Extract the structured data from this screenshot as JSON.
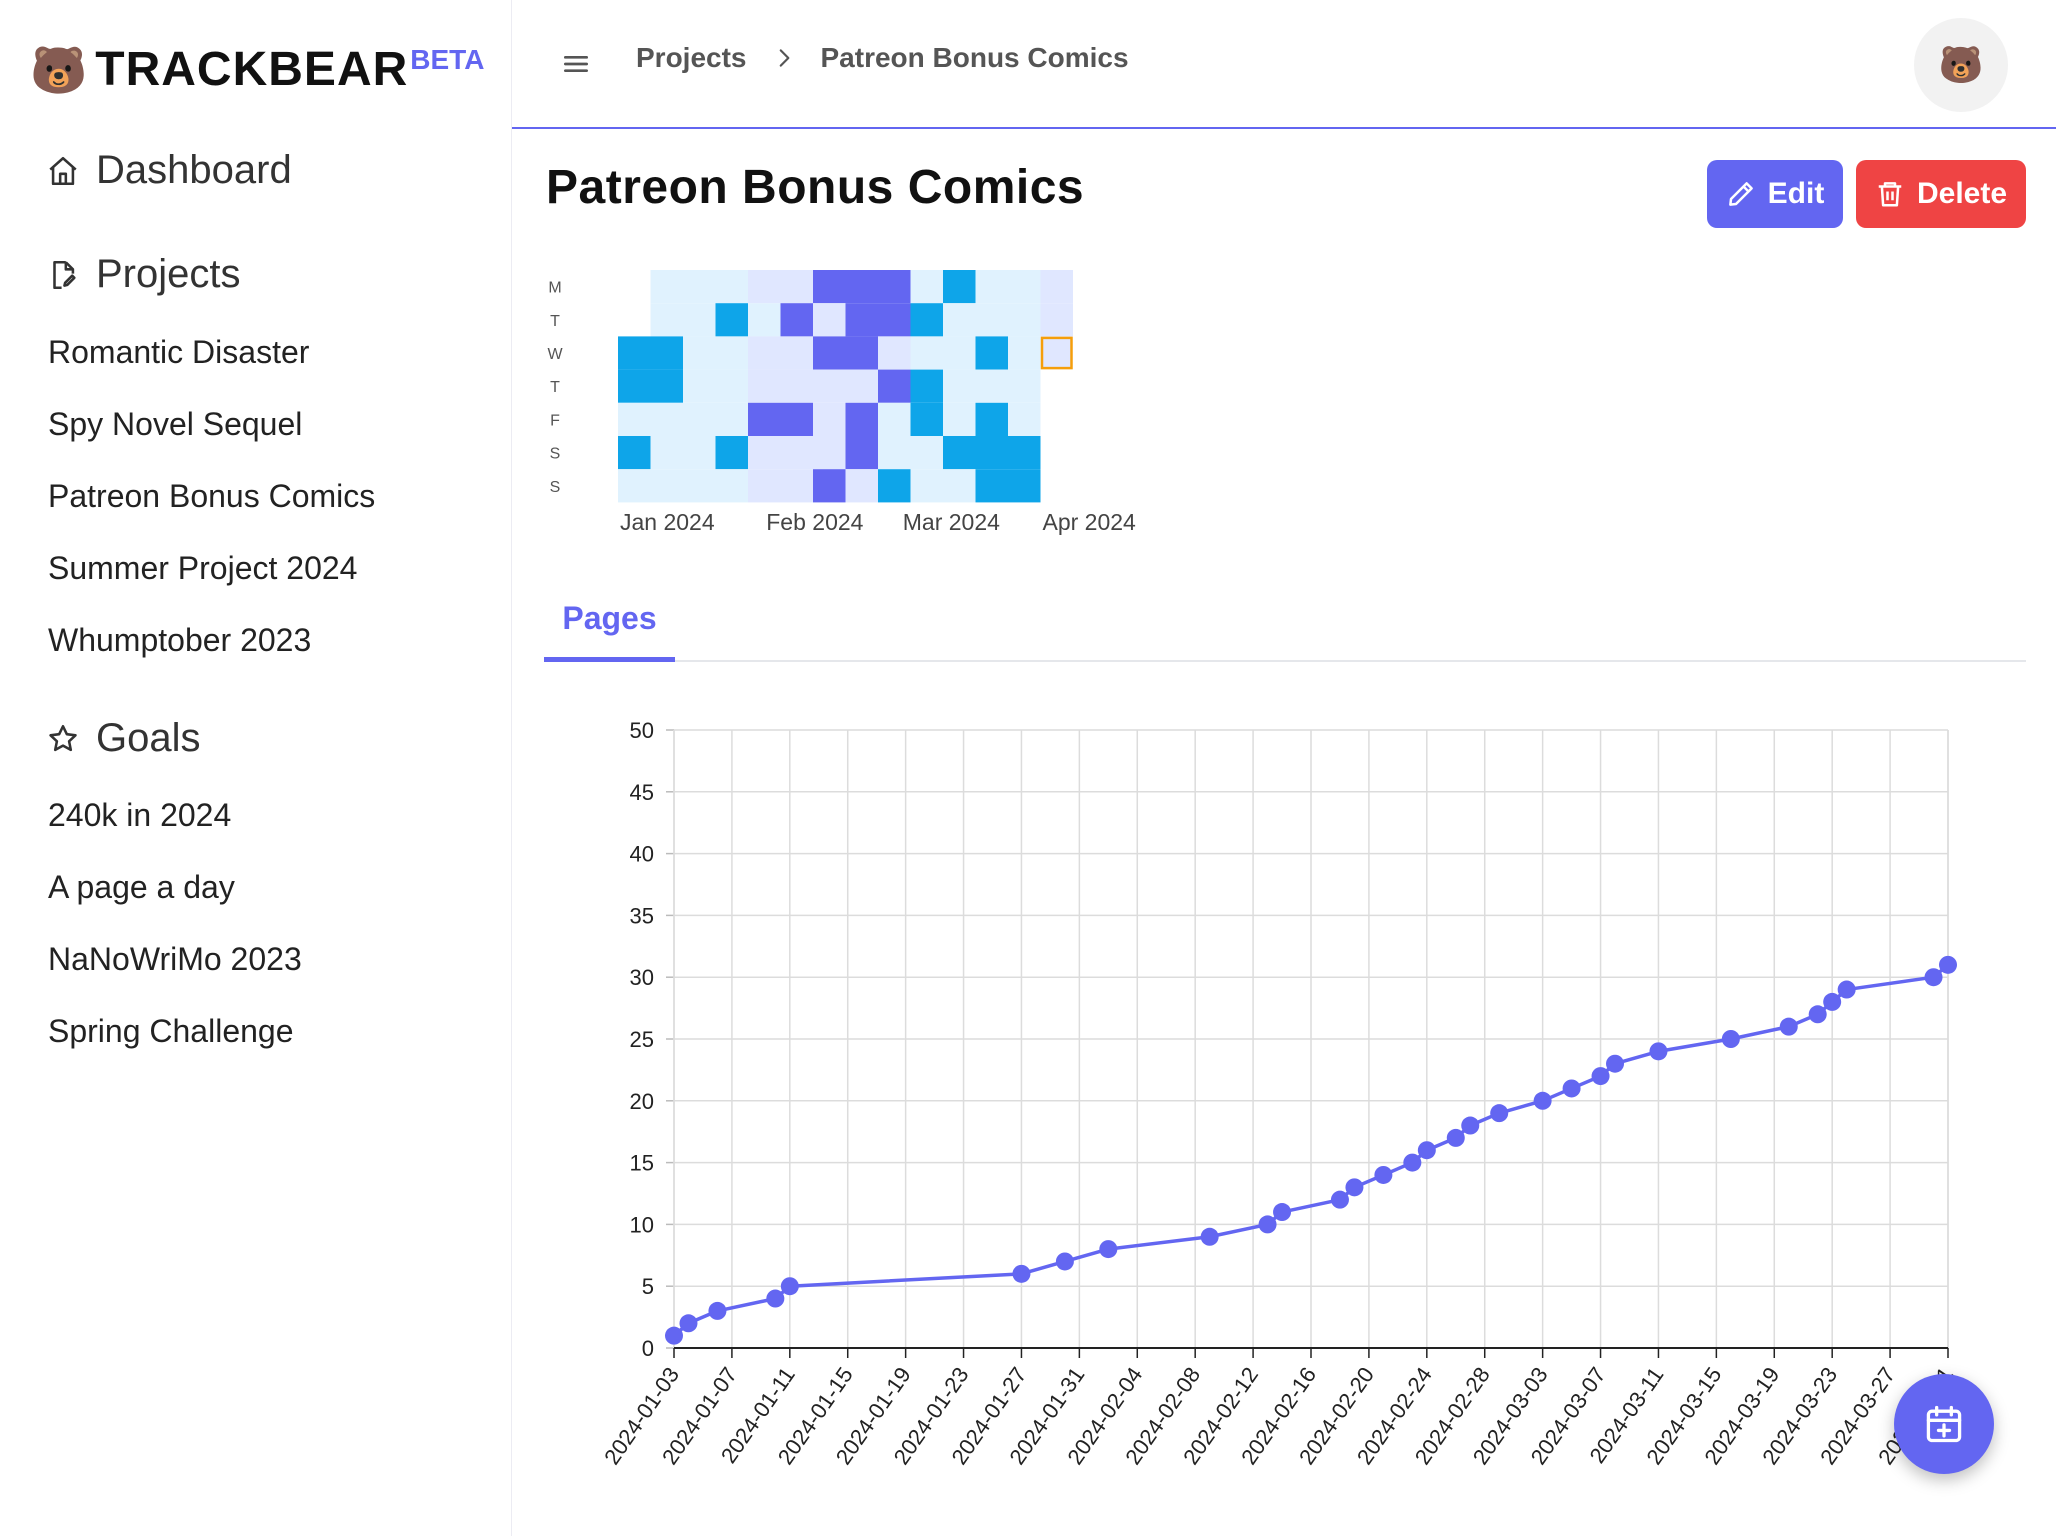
{
  "app": {
    "bear": "🐻",
    "name": "TRACKBEAR",
    "badge": "BETA"
  },
  "sidebar": {
    "dashboard": "Dashboard",
    "projects_header": "Projects",
    "projects": [
      "Romantic Disaster",
      "Spy Novel Sequel",
      "Patreon Bonus Comics",
      "Summer Project 2024",
      "Whumptober 2023"
    ],
    "goals_header": "Goals",
    "goals": [
      "240k in 2024",
      "A page a day",
      "NaNoWriMo 2023",
      "Spring Challenge"
    ]
  },
  "topbar": {
    "breadcrumb": [
      "Projects",
      "Patreon Bonus Comics"
    ],
    "avatar": "🐻",
    "icons": {
      "menu": "menu-icon",
      "separator": "chevron-right-icon"
    }
  },
  "project": {
    "title": "Patreon Bonus Comics",
    "edit_label": "Edit",
    "delete_label": "Delete"
  },
  "colors": {
    "accent": "#6366f1",
    "danger": "#ef4444",
    "heat_strong": "#0ea5e9",
    "heat_light": "#e0f2fe",
    "heat_alt": "#e0e7ff",
    "heat_purple": "#6366f1",
    "today": "#f59e0b"
  },
  "heatmap": {
    "day_labels": [
      "M",
      "T",
      "W",
      "T",
      "F",
      "S",
      "S"
    ],
    "month_labels": [
      {
        "text": "Jan 2024",
        "week": 0
      },
      {
        "text": "Feb 2024",
        "week": 4.5
      },
      {
        "text": "Mar 2024",
        "week": 8.7
      },
      {
        "text": "Apr 2024",
        "week": 13
      }
    ],
    "weeks": [
      [
        null,
        null,
        "B",
        "B",
        "L",
        "B",
        "L"
      ],
      [
        "L",
        "L",
        "B",
        "B",
        "L",
        "L",
        "L"
      ],
      [
        "L",
        "L",
        "L",
        "L",
        "L",
        "L",
        "L"
      ],
      [
        "L",
        "B",
        "L",
        "L",
        "L",
        "B",
        "L"
      ],
      [
        "A",
        "L",
        "A",
        "A",
        "P",
        "A",
        "A"
      ],
      [
        "A",
        "P",
        "A",
        "A",
        "P",
        "A",
        "A"
      ],
      [
        "P",
        "A",
        "P",
        "A",
        "A",
        "A",
        "P"
      ],
      [
        "P",
        "P",
        "P",
        "A",
        "P",
        "P",
        "A"
      ],
      [
        "P",
        "P",
        "A",
        "P",
        "L",
        "L",
        "B"
      ],
      [
        "L",
        "B",
        "L",
        "B",
        "B",
        "L",
        "L"
      ],
      [
        "B",
        "L",
        "L",
        "L",
        "L",
        "B",
        "L"
      ],
      [
        "L",
        "L",
        "B",
        "L",
        "B",
        "B",
        "B"
      ],
      [
        "L",
        "L",
        "L",
        "L",
        "L",
        "B",
        "B"
      ],
      [
        "A",
        "A",
        "T",
        null,
        null,
        null,
        null
      ]
    ]
  },
  "tabs": [
    {
      "label": "Pages",
      "active": true
    }
  ],
  "chart_data": {
    "type": "line",
    "title": "",
    "xlabel": "",
    "ylabel": "",
    "ylim": [
      0,
      50
    ],
    "yticks": [
      0,
      5,
      10,
      15,
      20,
      25,
      30,
      35,
      40,
      45,
      50
    ],
    "x_range": [
      "2024-01-03",
      "2024-03-31"
    ],
    "xticks": [
      "2024-01-03",
      "2024-01-07",
      "2024-01-11",
      "2024-01-15",
      "2024-01-19",
      "2024-01-23",
      "2024-01-27",
      "2024-01-31",
      "2024-02-04",
      "2024-02-08",
      "2024-02-12",
      "2024-02-16",
      "2024-02-20",
      "2024-02-24",
      "2024-02-28",
      "2024-03-03",
      "2024-03-07",
      "2024-03-11",
      "2024-03-15",
      "2024-03-19",
      "2024-03-23",
      "2024-03-27",
      "2024-03-31"
    ],
    "series": [
      {
        "color": "#6366f1",
        "points": [
          [
            "2024-01-03",
            1
          ],
          [
            "2024-01-04",
            2
          ],
          [
            "2024-01-06",
            3
          ],
          [
            "2024-01-10",
            4
          ],
          [
            "2024-01-11",
            5
          ],
          [
            "2024-01-27",
            6
          ],
          [
            "2024-01-30",
            7
          ],
          [
            "2024-02-02",
            8
          ],
          [
            "2024-02-09",
            9
          ],
          [
            "2024-02-13",
            10
          ],
          [
            "2024-02-14",
            11
          ],
          [
            "2024-02-18",
            12
          ],
          [
            "2024-02-19",
            13
          ],
          [
            "2024-02-21",
            14
          ],
          [
            "2024-02-23",
            15
          ],
          [
            "2024-02-24",
            16
          ],
          [
            "2024-02-26",
            17
          ],
          [
            "2024-02-27",
            18
          ],
          [
            "2024-02-29",
            19
          ],
          [
            "2024-03-03",
            20
          ],
          [
            "2024-03-05",
            21
          ],
          [
            "2024-03-07",
            22
          ],
          [
            "2024-03-08",
            23
          ],
          [
            "2024-03-11",
            24
          ],
          [
            "2024-03-16",
            25
          ],
          [
            "2024-03-20",
            26
          ],
          [
            "2024-03-22",
            27
          ],
          [
            "2024-03-23",
            28
          ],
          [
            "2024-03-24",
            29
          ],
          [
            "2024-03-30",
            30
          ],
          [
            "2024-03-31",
            31
          ]
        ]
      }
    ]
  }
}
